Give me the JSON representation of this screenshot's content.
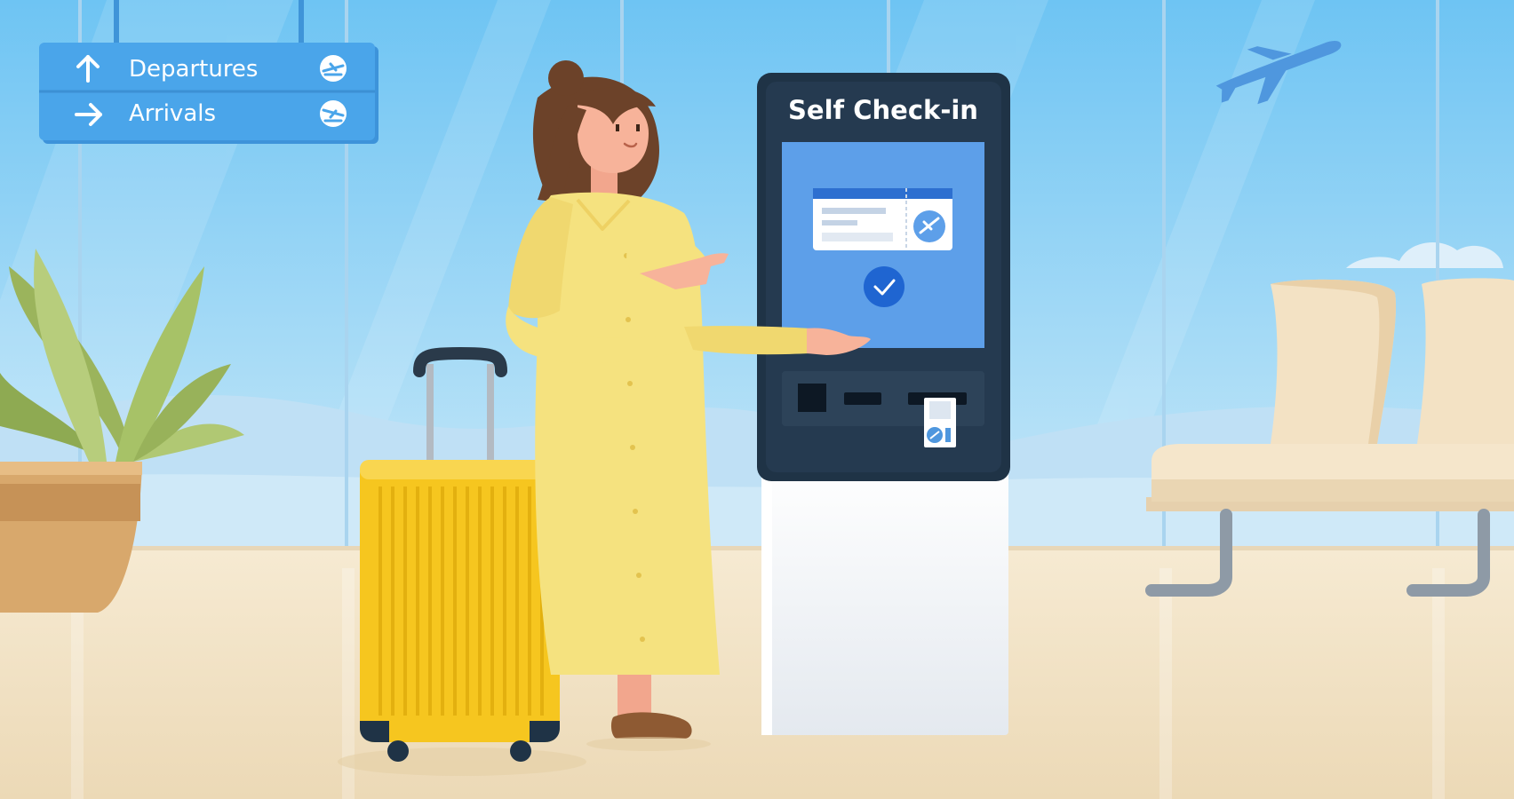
{
  "sign": {
    "departures_label": "Departures",
    "arrivals_label": "Arrivals",
    "departures_arrow_icon": "arrow-up-icon",
    "arrivals_arrow_icon": "arrow-right-icon",
    "flight_icon": "plane-icon"
  },
  "kiosk": {
    "title": "Self Check-in",
    "screen_icons": [
      "boarding-pass-icon",
      "checkmark-icon"
    ]
  },
  "colors": {
    "sky": "#7ecbf5",
    "sign_blue": "#4aa5ea",
    "kiosk_dark": "#1f3346",
    "screen_blue": "#5d9fe9",
    "suitcase_yellow": "#f6c61f",
    "dress_yellow": "#f5e27f",
    "floor": "#f0e2c6"
  }
}
